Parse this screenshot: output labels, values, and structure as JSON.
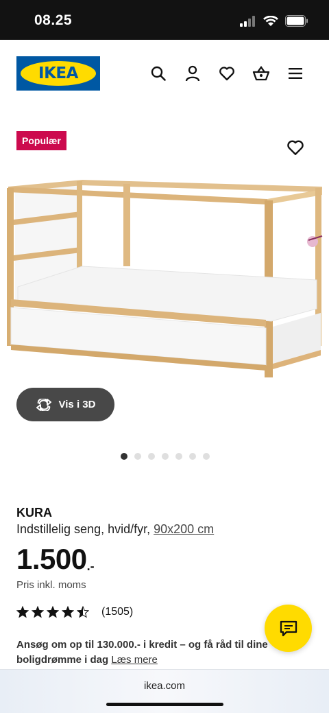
{
  "status_bar": {
    "time": "08.25",
    "icons": [
      "signal-icon",
      "wifi-icon",
      "battery-icon"
    ]
  },
  "header": {
    "logo_text": "IKEA",
    "icons": [
      "search-icon",
      "profile-icon",
      "heart-icon",
      "basket-icon",
      "menu-icon"
    ]
  },
  "product": {
    "badge": "Populær",
    "view_3d_label": "Vis i 3D",
    "carousel": {
      "total": 7,
      "active_index": 0
    },
    "name": "KURA",
    "description": "Indstillelig seng, hvid/fyr,",
    "size_link": "90x200 cm",
    "price": "1.500",
    "price_suffix": ".-",
    "vat_note": "Pris inkl. moms",
    "rating": {
      "stars": 4.5,
      "max": 5,
      "review_count": "(1505)"
    },
    "credit_text": "Ansøg om op til 130.000.- i kredit – og få råd til dine boligdrømme i dag",
    "credit_link": "Læs mere"
  },
  "browser": {
    "url": "ikea.com"
  },
  "colors": {
    "ikea_blue": "#0058a3",
    "ikea_yellow": "#ffdb00",
    "badge_red": "#cc0a4e",
    "button_dark": "#484848"
  }
}
